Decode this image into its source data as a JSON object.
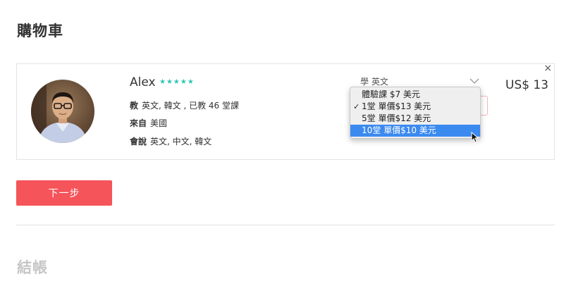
{
  "page_title": "購物車",
  "tutor": {
    "name": "Alex",
    "rating": 5,
    "stars": "★★★★★",
    "teaches_label": "教",
    "teaches_value": "英文, 韓文 , 已教 46 堂課",
    "from_label": "來自",
    "from_value": "美國",
    "speaks_label": "會說",
    "speaks_value": "英文, 中文, 韓文"
  },
  "course_select": {
    "value": "學 英文",
    "options": [
      {
        "label": "體驗課 $7 美元",
        "checked": false,
        "highlighted": false
      },
      {
        "label": "1堂 單價$13 美元",
        "checked": true,
        "highlighted": false
      },
      {
        "label": "5堂 單價$12 美元",
        "checked": false,
        "highlighted": false
      },
      {
        "label": "10堂 單價$10 美元",
        "checked": false,
        "highlighted": true
      }
    ],
    "check_mark": "✓"
  },
  "price": "US$ 13",
  "close_symbol": "×",
  "next_button_label": "下一步",
  "checkout_title": "結帳",
  "colors": {
    "accent": "#f4545a",
    "stars": "#2ec4b6",
    "highlight": "#3b8af0"
  }
}
